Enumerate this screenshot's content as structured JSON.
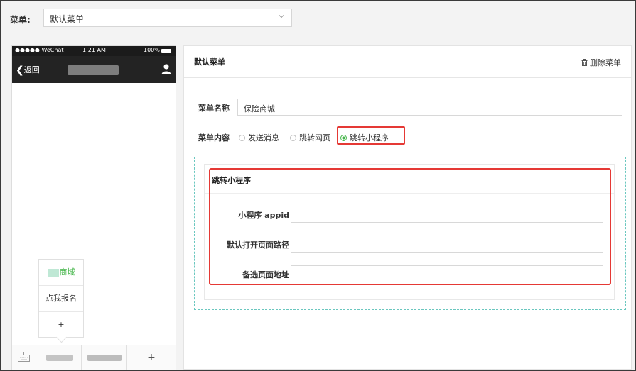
{
  "topbar": {
    "label": "菜单:",
    "select_value": "默认菜单"
  },
  "phone": {
    "status_left": "●●●●● WeChat ",
    "status_time": "1:21 AM",
    "status_right": "100%",
    "back_label": "返回",
    "submenu": [
      {
        "label": "商城",
        "active": true
      },
      {
        "label": "点我报名",
        "active": false
      },
      {
        "label": "+",
        "active": false
      }
    ],
    "bottom_plus": "+"
  },
  "panel": {
    "title": "默认菜单",
    "delete_label": "删除菜单",
    "name_label": "菜单名称",
    "name_value": "保险商城",
    "content_label": "菜单内容",
    "options": [
      {
        "label": "发送消息",
        "selected": false
      },
      {
        "label": "跳转网页",
        "selected": false
      },
      {
        "label": "跳转小程序",
        "selected": true
      }
    ],
    "mini": {
      "title": "跳转小程序",
      "fields": [
        {
          "label": "小程序 appid",
          "value": ""
        },
        {
          "label": "默认打开页面路径",
          "value": ""
        },
        {
          "label": "备选页面地址",
          "value": ""
        }
      ]
    }
  },
  "colors": {
    "accent": "#44b549",
    "highlight": "#e53935",
    "dashed": "#6ac7bf"
  }
}
